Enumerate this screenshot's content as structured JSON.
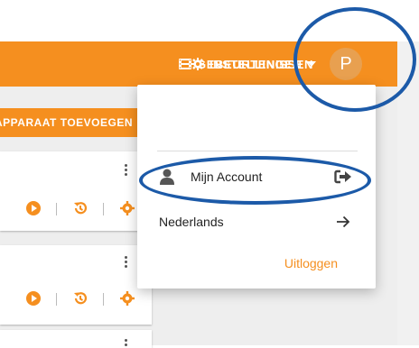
{
  "nav": {
    "events_label": "GEBEURTENISSEN",
    "settings_label": "INSTELLINGEN",
    "avatar_letter": "P"
  },
  "toolbar": {
    "add_device_label": "APPARAAT TOEVOEGEN"
  },
  "dropdown": {
    "account_label": "Mijn Account",
    "language_label": "Nederlands",
    "logout_label": "Uitloggen"
  },
  "colors": {
    "accent": "#f58f1f",
    "annotation": "#1c5aa8"
  },
  "icons": {
    "events": "film-icon",
    "settings": "gear-icon",
    "account": "user-icon",
    "account_action": "sign-out-icon",
    "language_action": "arrow-right-icon"
  }
}
